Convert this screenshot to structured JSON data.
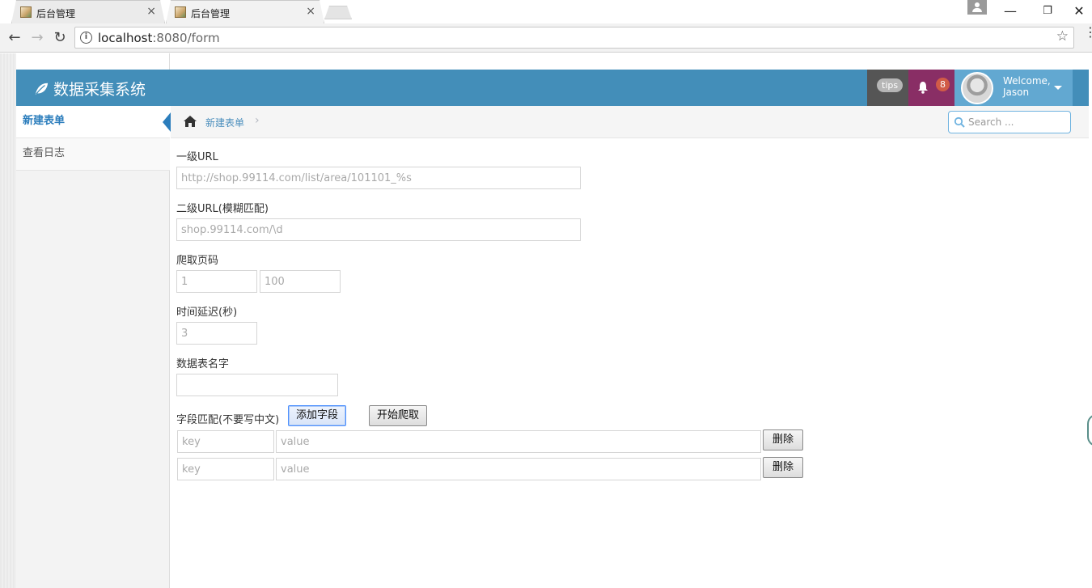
{
  "browser": {
    "tabs": [
      {
        "title": "后台管理",
        "close": "×",
        "active": false
      },
      {
        "title": "后台管理",
        "close": "×",
        "active": true
      }
    ],
    "window_controls": {
      "minimize": "—",
      "restore": "❐",
      "close": "✕"
    },
    "nav": {
      "back": "←",
      "forward": "→",
      "reload": "↻"
    },
    "address": {
      "host": "localhost",
      "path": ":8080/form"
    },
    "star": "☆",
    "menu": "⋮"
  },
  "app": {
    "brand": "数据采集系统",
    "tips": "tips",
    "notification_count": "8",
    "welcome_line1": "Welcome,",
    "welcome_line2": "Jason",
    "colors": {
      "header": "#438eb9",
      "tips": "#555555",
      "bell": "#892e65",
      "user": "#62a8d1",
      "badge": "#d15b47"
    }
  },
  "sidebar": {
    "items": [
      {
        "label": "新建表单",
        "active": true
      },
      {
        "label": "查看日志",
        "active": false
      }
    ]
  },
  "breadcrumb": {
    "current": "新建表单",
    "separator": "›"
  },
  "search": {
    "placeholder": "Search ..."
  },
  "form": {
    "level1_url": {
      "label": "一级URL",
      "placeholder": "http://shop.99114.com/list/area/101101_%s"
    },
    "level2_url": {
      "label": "二级URL(模糊匹配)",
      "placeholder": "shop.99114.com/\\d"
    },
    "pages": {
      "label": "爬取页码",
      "from_placeholder": "1",
      "to_placeholder": "100"
    },
    "delay": {
      "label": "时间延迟(秒)",
      "placeholder": "3"
    },
    "table_name": {
      "label": "数据表名字",
      "value": ""
    },
    "fields": {
      "label": "字段匹配(不要写中文)",
      "add_button": "添加字段",
      "start_button": "开始爬取",
      "rows": [
        {
          "key_placeholder": "key",
          "value_placeholder": "value",
          "delete": "删除"
        },
        {
          "key_placeholder": "key",
          "value_placeholder": "value",
          "delete": "删除"
        }
      ]
    }
  }
}
